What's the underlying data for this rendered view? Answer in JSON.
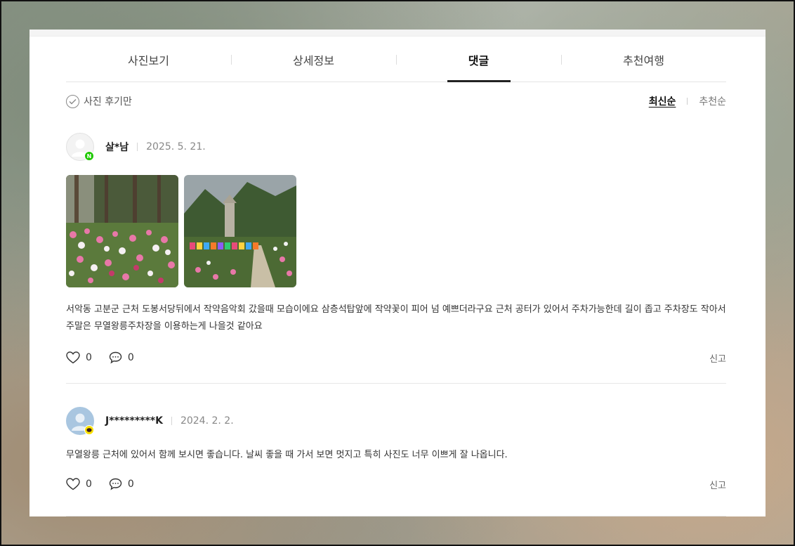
{
  "tabs": [
    {
      "label": "사진보기"
    },
    {
      "label": "상세정보"
    },
    {
      "label": "댓글",
      "active": true
    },
    {
      "label": "추천여행"
    }
  ],
  "filter": {
    "photo_only_label": "사진 후기만"
  },
  "sort": {
    "latest": "최신순",
    "recommended": "추천순"
  },
  "reviews": [
    {
      "nickname": "살*남",
      "date": "2025. 5. 21.",
      "badge": "N",
      "text": "서악동 고분군 근처 도봉서당뒤에서 작약음악회 갔을때 모습이에요 삼층석탑앞에 작약꽃이 피어 넘 예쁘더라구요 근처 공터가 있어서 주차가능한데 길이 좁고 주차장도 작아서 주말은 무열왕릉주차장을 이용하는게 나을것 같아요",
      "likes": "0",
      "comments": "0",
      "report": "신고"
    },
    {
      "nickname": "J*********K",
      "date": "2024. 2. 2.",
      "text": "무열왕릉 근처에 있어서 함께 보시면 좋습니다. 날씨 좋을 때 가서 보면 멋지고 특히 사진도 너무 이쁘게 잘 나옵니다.",
      "likes": "0",
      "comments": "0",
      "report": "신고"
    }
  ],
  "colors": {
    "naver_badge": "#1ec800",
    "kakao_badge": "#f9e000",
    "active_tab": "#222222"
  }
}
